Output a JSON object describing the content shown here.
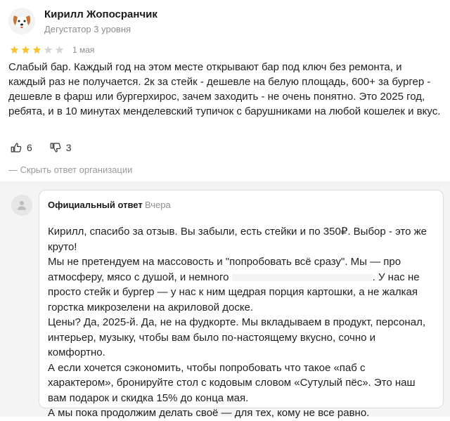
{
  "review": {
    "author_name": "Кирилл Жопосранчик",
    "author_level": "Дегустатор 3 уровня",
    "rating": 3,
    "rating_max": 5,
    "date": "1 мая",
    "text": "Слабый бар. Каждый год на этом месте открывают бар под ключ без ремонта, и каждый раз не получается. 2к за стейк - дешевле на белую площадь, 600+ за бургер - дешевле в фарш или бургерхирос, зачем заходить - не очень понятно. Это 2025 год, ребята, и в 10 минутах менделевский тупичок с барушниками на любой кошелек и вкус.",
    "likes": "6",
    "dislikes": "3",
    "hide_response_label": "— Скрыть ответ организации",
    "colors": {
      "star_filled": "#fbc02d",
      "star_empty": "#d6d6d6"
    }
  },
  "response": {
    "label": "Официальный ответ",
    "date": "Вчера",
    "paragraphs": {
      "p1": "Кирилл, спасибо за отзыв. Вы забыли, есть стейки и по 350₽. Выбор - это же круто!",
      "p2_start": "Мы не претендуем на массовость и \"попробовать всё сразу\". Мы — про атмосферу, мясо с душой, и немного",
      "p2_end": ". У нас не просто стейк и бургер — у нас к ним щедрая порция картошки, а не жалкая горстка микрозелени на акриловой доске.",
      "p3": "Цены? Да, 2025-й. Да, не на фудкорте. Мы вкладываем в продукт, персонал, интерьер, музыку, чтобы вам было по-настоящему вкусно, сочно и комфортно.",
      "p4": "А если хочется сэкономить, чтобы попробовать что такое «паб с характером», бронируйте стол с кодовым словом «Сутулый пёс». Это наш вам подарок и скидка 15% до конца мая.",
      "p5": "А мы пока продолжим делать своё — для тех, кому не все равно."
    }
  }
}
